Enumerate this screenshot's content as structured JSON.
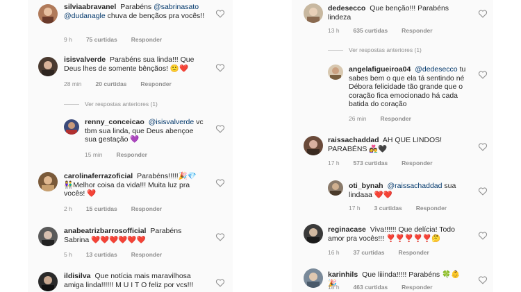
{
  "left": {
    "comments": [
      {
        "user": "silviaabravanel",
        "parts": [
          {
            "t": " Parabéns "
          },
          {
            "t": "@sabrinasato",
            "m": true
          },
          {
            "t": " "
          },
          {
            "t": "@dudanagle",
            "m": true
          },
          {
            "t": " chuva de bençãos pra vocês!!"
          }
        ],
        "time": "9 h",
        "likes": "75 curtidas",
        "reply": "Responder"
      },
      {
        "user": "isisvalverde",
        "parts": [
          {
            "t": " Parabéns sua linda!!! Que Deus lhes de somente bênçãos! 🙂❤️"
          }
        ],
        "time": "28 min",
        "likes": "20 curtidas",
        "reply": "Responder",
        "view_replies": "Ver respostas anteriores (1)"
      },
      {
        "user": "renny_conceicao",
        "parts": [
          {
            "t": " "
          },
          {
            "t": "@isisvalverde",
            "m": true
          },
          {
            "t": " vc tbm sua linda, que Deus abençoe sua gestação 💜"
          }
        ],
        "time": "15 min",
        "likes": "",
        "reply": "Responder"
      },
      {
        "user": "carolinaferrazoficial",
        "parts": [
          {
            "t": " Parabéns!!!!!🎉💎 👫Melhor coisa da vida!!! Muita luz pra vocês! ❤️"
          }
        ],
        "time": "2 h",
        "likes": "15 curtidas",
        "reply": "Responder"
      },
      {
        "user": "anabeatrizbarrosofficial",
        "parts": [
          {
            "t": " Parabéns Sabrina ❤️❤️❤️❤️❤️❤️"
          }
        ],
        "time": "5 h",
        "likes": "13 curtidas",
        "reply": "Responder"
      },
      {
        "user": "ildisilva",
        "parts": [
          {
            "t": " Que notícia mais maravilhosa amiga linda!!!!!! M U I T O feliz por vcs!!!"
          }
        ],
        "time": "",
        "likes": "",
        "reply": ""
      }
    ]
  },
  "right": {
    "comments": [
      {
        "user": "dedesecco",
        "parts": [
          {
            "t": " Que benção!!! Parabéns lindeza"
          }
        ],
        "time": "13 h",
        "likes": "635 curtidas",
        "reply": "Responder",
        "view_replies": "Ver respostas anteriores (1)"
      },
      {
        "user": "angelafigueiroa04",
        "parts": [
          {
            "t": " "
          },
          {
            "t": "@dedesecco",
            "m": true
          },
          {
            "t": " tu sabes bem o que ela tá sentindo né Débora felicidade tão grande que o coração fica emocionado há cada batida do coração"
          }
        ],
        "time": "26 min",
        "likes": "",
        "reply": "Responder"
      },
      {
        "user": "raissachaddad",
        "parts": [
          {
            "t": " AH QUE LINDOS! PARABÉNS 👩‍❤️‍👨🖤"
          }
        ],
        "time": "17 h",
        "likes": "573 curtidas",
        "reply": "Responder"
      },
      {
        "user": "oti_bynah",
        "parts": [
          {
            "t": " "
          },
          {
            "t": "@raissachaddad",
            "m": true
          },
          {
            "t": " sua lindaaa ❤️❤️"
          }
        ],
        "time": "17 h",
        "likes": "3 curtidas",
        "reply": "Responder"
      },
      {
        "user": "reginacase",
        "parts": [
          {
            "t": " Viva!!!!!! Que delícia! Todo amor pra vocês!!! ❣️❣️❣️❣️❣️🤔"
          }
        ],
        "time": "16 h",
        "likes": "37 curtidas",
        "reply": "Responder"
      },
      {
        "user": "karinhils",
        "parts": [
          {
            "t": " Que liiinda!!!!! Parabéns 🍀👶🎉"
          }
        ],
        "time": "18 h",
        "likes": "463 curtidas",
        "reply": "Responder"
      }
    ]
  }
}
